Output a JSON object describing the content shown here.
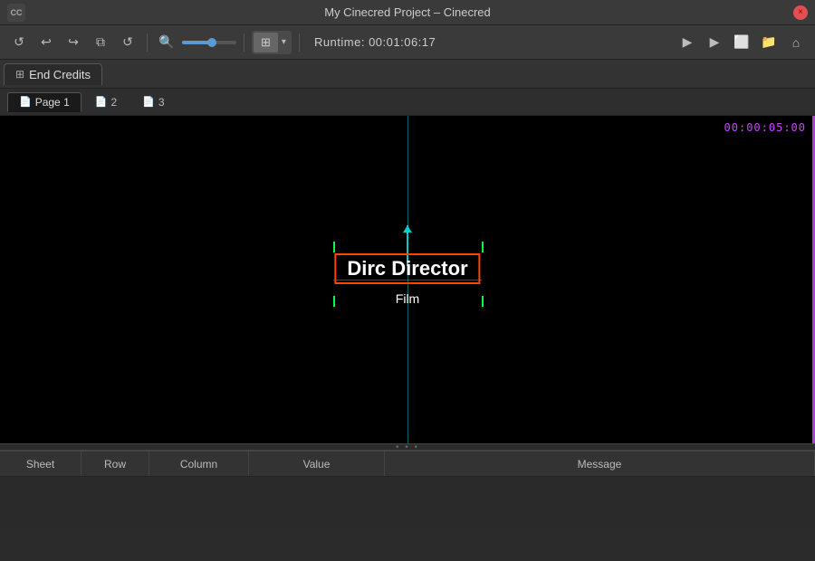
{
  "titleBar": {
    "title": "My Cinecred Project – Cinecred",
    "logo": "CC",
    "closeButton": "×"
  },
  "toolbar": {
    "refreshIcon": "↺",
    "undoIcon": "↩",
    "redoIcon": "↪",
    "copyIcon": "⧉",
    "revertIcon": "↺",
    "searchIcon": "🔍",
    "runtime": "Runtime:  00:01:06:17",
    "playIcon": "▶",
    "playIcon2": "▶",
    "frameIcon": "⬜",
    "folderIcon": "📁",
    "homeIcon": "⌂",
    "viewGridIcon": "⊞",
    "viewArrow": "▾"
  },
  "mainTab": {
    "label": "End Credits",
    "icon": "⊞"
  },
  "pageTabs": [
    {
      "label": "Page 1",
      "icon": "📄",
      "active": true
    },
    {
      "label": "2",
      "icon": "📄",
      "active": false
    },
    {
      "label": "3",
      "icon": "📄",
      "active": false
    }
  ],
  "preview": {
    "timecode": "00:00:05:00",
    "creditName": "Dirc Director",
    "creditRole": "Film"
  },
  "bottomPanel": {
    "resizeDots": "• • •",
    "columns": [
      {
        "label": "Sheet",
        "key": "sheet"
      },
      {
        "label": "Row",
        "key": "row"
      },
      {
        "label": "Column",
        "key": "column"
      },
      {
        "label": "Value",
        "key": "value"
      },
      {
        "label": "Message",
        "key": "message"
      }
    ]
  }
}
